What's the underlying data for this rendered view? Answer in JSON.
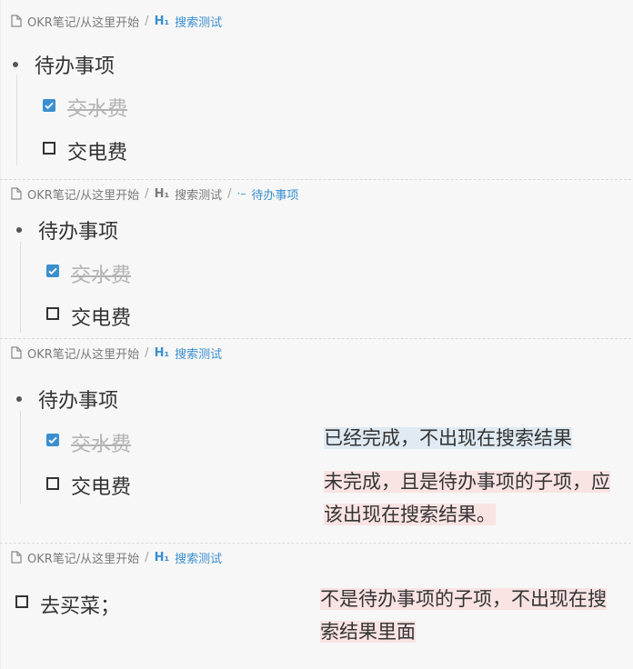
{
  "blocks": [
    {
      "breadcrumb": {
        "root": "OKR笔记/从这里开始",
        "sep": "/",
        "h1": "H₁",
        "title": "搜索测试"
      },
      "parent": "待办事项",
      "children": [
        {
          "text": "交水费",
          "checked": true
        },
        {
          "text": "交电费",
          "checked": false
        }
      ]
    },
    {
      "breadcrumb": {
        "root": "OKR笔记/从这里开始",
        "sep": "/",
        "h1": "H₁",
        "title": "搜索测试",
        "sep2": "/",
        "leaf": "待办事项"
      },
      "parent": "待办事项",
      "children": [
        {
          "text": "交水费",
          "checked": true
        },
        {
          "text": "交电费",
          "checked": false
        }
      ]
    },
    {
      "breadcrumb": {
        "root": "OKR笔记/从这里开始",
        "sep": "/",
        "h1": "H₁",
        "title": "搜索测试"
      },
      "parent": "待办事项",
      "children": [
        {
          "text": "交水费",
          "checked": true
        },
        {
          "text": "交电费",
          "checked": false
        }
      ],
      "notes": [
        "已经完成，不出现在搜索结果",
        "未完成，且是待办事项的子项，应",
        "该出现在搜索结果。"
      ]
    },
    {
      "breadcrumb": {
        "root": "OKR笔记/从这里开始",
        "sep": "/",
        "h1": "H₁",
        "title": "搜索测试"
      },
      "item": {
        "text": "去买菜；",
        "checked": false
      },
      "notes": [
        "不是待办事项的子项，不出现在搜",
        "索结果里面"
      ]
    }
  ],
  "colors": {
    "accent": "#3a8fd0",
    "note_blue": "#dfeaf2",
    "note_red": "#f9e3e3"
  },
  "icons": {
    "doc": "document-icon",
    "list": "list-icon"
  }
}
